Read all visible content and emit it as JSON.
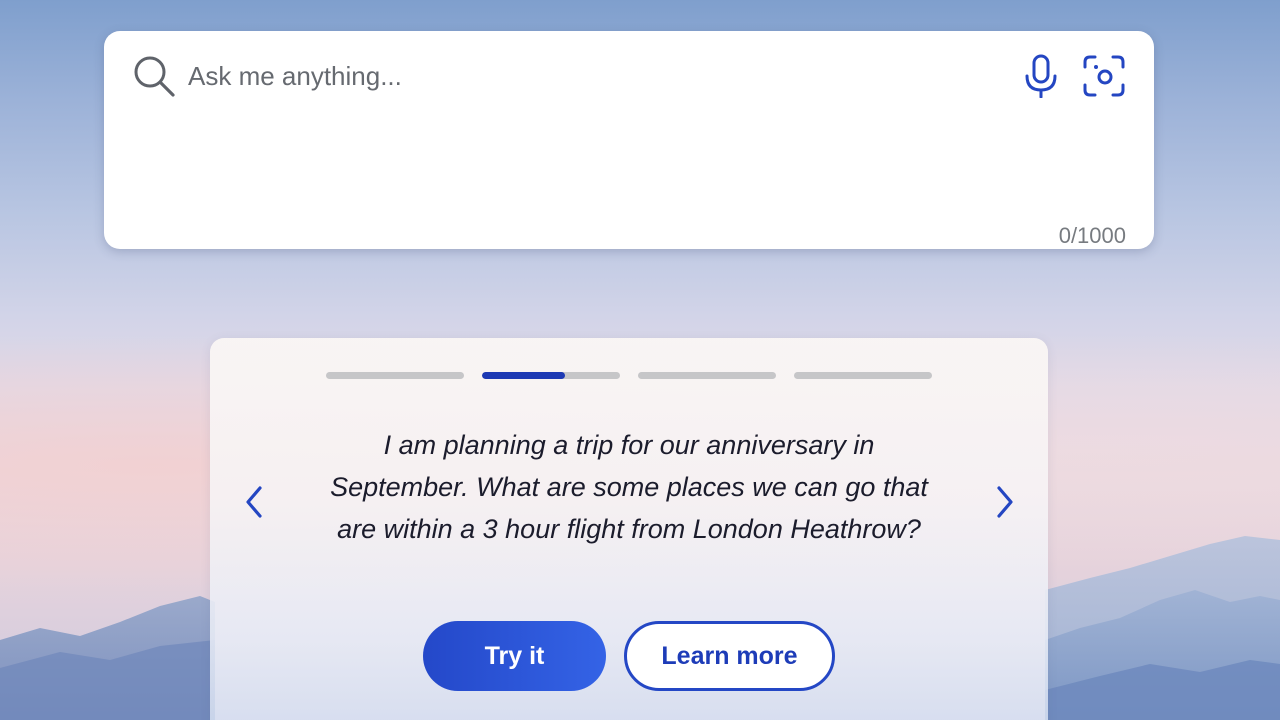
{
  "search": {
    "placeholder": "Ask me anything...",
    "char_count": "0/1000",
    "icons": {
      "search": "search-icon",
      "microphone": "microphone-icon",
      "visual_search": "visual-search-icon"
    }
  },
  "carousel": {
    "pages": [
      {
        "progress": 0
      },
      {
        "progress": 0.6
      },
      {
        "progress": 0
      },
      {
        "progress": 0
      }
    ],
    "active_index": 1,
    "prompt": "I am planning a trip for our anniversary in September. What are some places we can go that are within a 3 hour flight from London Heathrow?",
    "prev_icon": "chevron-left-icon",
    "next_icon": "chevron-right-icon",
    "buttons": {
      "try_label": "Try it",
      "learn_label": "Learn more"
    }
  },
  "colors": {
    "accent": "#1d39b4",
    "button_gradient_start": "#2448c9",
    "button_gradient_end": "#3463e6",
    "progress_track": "#c6c6c8",
    "text_dark": "#1b1c2c"
  }
}
